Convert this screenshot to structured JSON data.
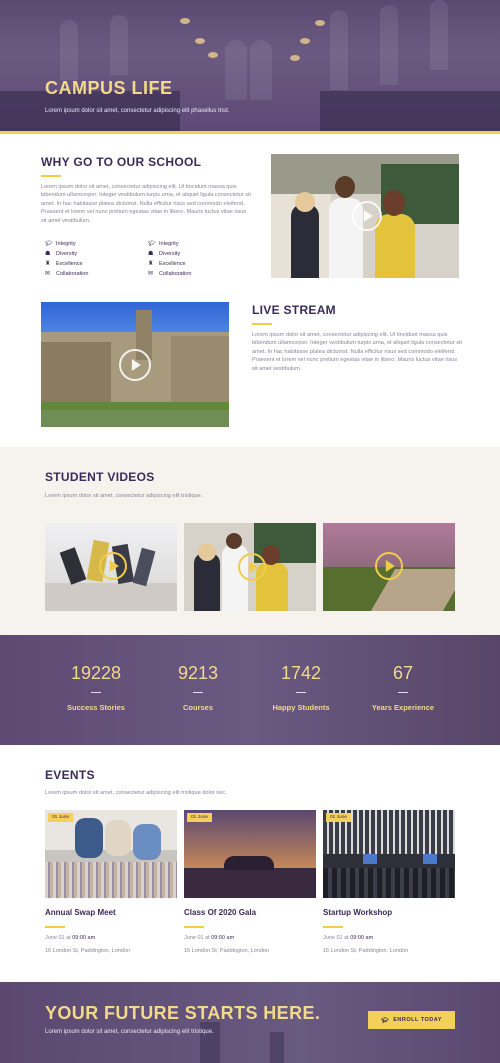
{
  "hero": {
    "title": "CAMPUS LIFE",
    "subtitle": "Lorem ipsum dolor sit amet, consectetur adipiscing elit phasellus tnst."
  },
  "why": {
    "title": "WHY GO TO OUR SCHOOL",
    "paragraph": "Lorem ipsum dolor sit amet, consectetur adipiscing elit. Ut tincidunt massa quis bibendum ullamcorper. Integer vestibulum turpis urna, et aliquet ligula consectetur sit amet. In hac habitasse platea dictumst. Nulla efficitur risus sed commodo eleifend. Praesent et lorem vel nunc pretium egestas vitae in libero. Mauris luctus vitae risus sit amet vestibulum.",
    "features_left": [
      {
        "icon": "graduation-cap-icon",
        "label": "Integrity"
      },
      {
        "icon": "group-icon",
        "label": "Diversity"
      },
      {
        "icon": "trophy-icon",
        "label": "Excellence"
      },
      {
        "icon": "chat-icon",
        "label": "Collaboration"
      }
    ],
    "features_right": [
      {
        "icon": "graduation-cap-icon",
        "label": "Integrity"
      },
      {
        "icon": "group-icon",
        "label": "Diversity"
      },
      {
        "icon": "trophy-icon",
        "label": "Excellence"
      },
      {
        "icon": "chat-icon",
        "label": "Collaboration"
      }
    ]
  },
  "live": {
    "title": "LIVE STREAM",
    "paragraph": "Lorem ipsum dolor sit amet, consectetur adipiscing elit. Ut tincidunt massa quis bibendum ullamcorper. Integer vestibulum turpis urna, et aliquet ligula consectetur sit amet. In hac habitasse platea dictumst. Nulla efficitur risus sed commodo eleifend. Praesent et lorem vel nunc pretium egestas vitae in libero. Mauris luctus vitae risus sit amet vestibulum."
  },
  "videos": {
    "title": "STUDENT VIDEOS",
    "subtitle": "Lorem ipsum dolor sit amet, consectetur adipiscing elit tristique."
  },
  "stats": [
    {
      "value": "19228",
      "label": "Success Stories"
    },
    {
      "value": "9213",
      "label": "Courses"
    },
    {
      "value": "1742",
      "label": "Happy Students"
    },
    {
      "value": "67",
      "label": "Years Experience"
    }
  ],
  "events": {
    "title": "EVENTS",
    "subtitle": "Lorem ipsum dolor sit amet, consectetur adipiscing elit tristique dolor nec.",
    "items": [
      {
        "date_tag": "01 June",
        "title": "Annual Swap Meet",
        "date_prefix": "June 01 at",
        "time": "09:00 am",
        "address": "16 London St, Paddington, London"
      },
      {
        "date_tag": "01 June",
        "title": "Class Of 2020 Gala",
        "date_prefix": "June 01 at",
        "time": "09:00 am",
        "address": "16 London St, Paddington, London"
      },
      {
        "date_tag": "01 June",
        "title": "Startup Workshop",
        "date_prefix": "June 01 at",
        "time": "09:00 am",
        "address": "16 London St, Paddington, London"
      }
    ]
  },
  "cta": {
    "title": "YOUR FUTURE STARTS HERE.",
    "subtitle": "Lorem ipsum dolor sit amet, consectetur adipiscing elit tristique.",
    "button": "ENROLL TODAY"
  },
  "colors": {
    "accent": "#f2d05a",
    "brand": "#3b2b5a"
  }
}
